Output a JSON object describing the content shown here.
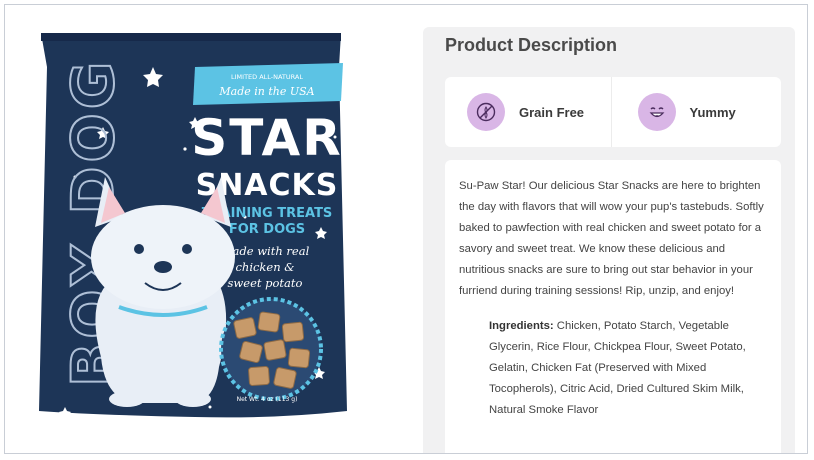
{
  "product": {
    "brand": "BOX DOG",
    "banner_line": "LIMITED ALL-NATURAL",
    "banner_made": "Made in the USA",
    "name_line1": "STAR",
    "name_line2": "SNACKS",
    "subtitle_line1": "TRAINING TREATS",
    "subtitle_line2": "FOR DOGS",
    "script_line1": "Made with real",
    "script_line2": "chicken &",
    "script_line3": "sweet potato",
    "net_weight": "Net Wt. 4 oz (113 g)",
    "colors": {
      "bag": "#1d3557",
      "banner": "#5cc3e4",
      "text": "#ffffff"
    }
  },
  "panel": {
    "title": "Product Description",
    "features": [
      {
        "label": "Grain Free",
        "icon": "no-grain-icon"
      },
      {
        "label": "Yummy",
        "icon": "smiley-face-icon"
      }
    ],
    "description": "Su-Paw Star! Our delicious Star Snacks are here to brighten the day with flavors that will wow your pup's tastebuds. Softly baked to pawfection with real chicken and sweet potato for a savory and sweet treat. We know these delicious and nutritious snacks are sure to bring out star behavior in your furriend during training sessions! Rip, unzip, and enjoy!",
    "ingredients_label": "Ingredients:",
    "ingredients_text": "Chicken, Potato Starch, Vegetable Glycerin, Rice Flour, Chickpea Flour, Sweet Potato, Gelatin, Chicken Fat (Preserved with Mixed Tocopherols), Citric Acid, Dried Cultured Skim Milk, Natural Smoke Flavor",
    "icon_bg": "#d9b6e6"
  }
}
